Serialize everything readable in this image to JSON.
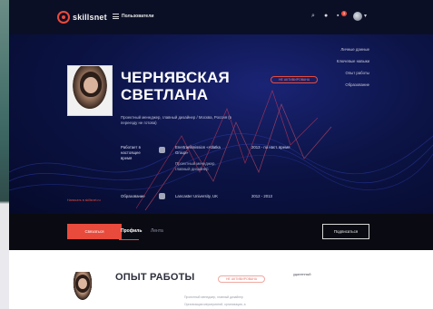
{
  "header": {
    "brand": "skillsnet",
    "nav_label": "Пользователи",
    "notif_count": "3",
    "icons": [
      "search-icon",
      "bell-icon",
      "chat-icon",
      "avatar",
      "chevron-down-icon"
    ]
  },
  "profile": {
    "name_line1": "ЧЕРНЯВСКАЯ",
    "name_line2": "СВЕТЛАНА",
    "role_line1": "Проектный менеджер, главный дизайнер / Москва, Россия (в",
    "role_line2": "переезду не готова)",
    "status_chip": "НЕ АКТИВИРОВАНА",
    "contact_link": "Написать в skillsnet.ru"
  },
  "right_nav": [
    "Личные данные",
    "Ключевые навыки",
    "Опыт работы",
    "Образование"
  ],
  "experience_block": {
    "label_line1": "Работает в",
    "label_line2": "настоящее",
    "label_line3": "время",
    "org": "Enertransmission «Atlatka",
    "org2": "Group»",
    "pos_line1": "Проектный менеджер,",
    "pos_line2": "главный дизайнер",
    "years": "2013 - по наст. время"
  },
  "education_block": {
    "label": "Образование",
    "org": "Lancaster University, UK",
    "years": "2012 - 2013"
  },
  "tabs": {
    "button": "Связаться",
    "profile": "Профиль",
    "feed": "Лента",
    "subscribe": "Подписаться"
  },
  "lower": {
    "title": "ОПЫТ РАБОТЫ",
    "chip": "НЕ АКТИВИРОВАНА",
    "side_note": "удаленный",
    "line1": "Проектный менеджер, главный дизайнер",
    "line2": "Организация мероприятий, организация, а"
  },
  "colors": {
    "accent": "#e84a3c",
    "hero_bg": "#0c1447",
    "tabrow_bg": "#0a0b12"
  }
}
